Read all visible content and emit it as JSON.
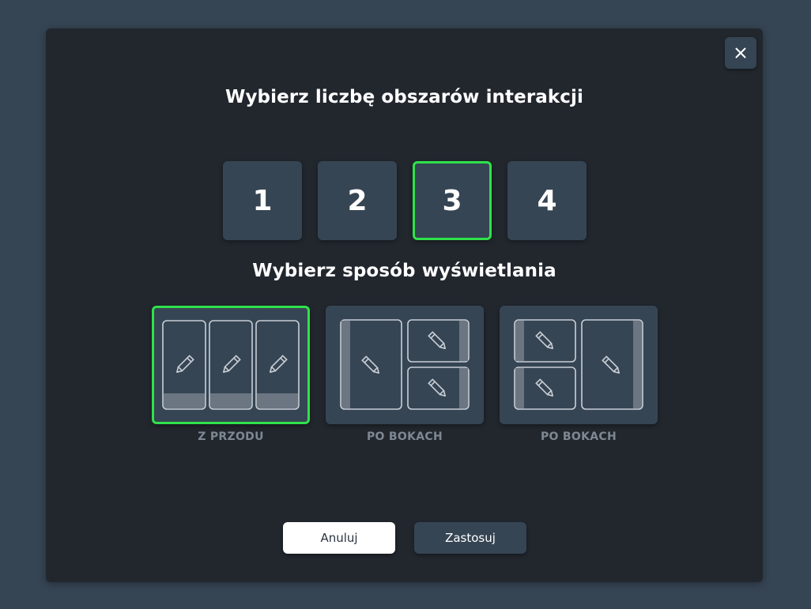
{
  "dialog": {
    "title_count": "Wybierz liczbę obszarów interakcji",
    "title_mode": "Wybierz sposób wyświetlania",
    "close_icon": "close-icon"
  },
  "counts": [
    {
      "label": "1",
      "selected": false
    },
    {
      "label": "2",
      "selected": false
    },
    {
      "label": "3",
      "selected": true
    },
    {
      "label": "4",
      "selected": false
    }
  ],
  "modes": [
    {
      "label": "Z PRZODU",
      "selected": true,
      "icon": "front-layout-icon"
    },
    {
      "label": "PO BOKACH",
      "selected": false,
      "icon": "sides-left-layout-icon"
    },
    {
      "label": "PO BOKACH",
      "selected": false,
      "icon": "sides-right-layout-icon"
    }
  ],
  "buttons": {
    "cancel": "Anuluj",
    "apply": "Zastosuj"
  },
  "colors": {
    "accent": "#2fe24a",
    "background": "#364554",
    "dialog": "#22272e",
    "tile": "#364554"
  }
}
